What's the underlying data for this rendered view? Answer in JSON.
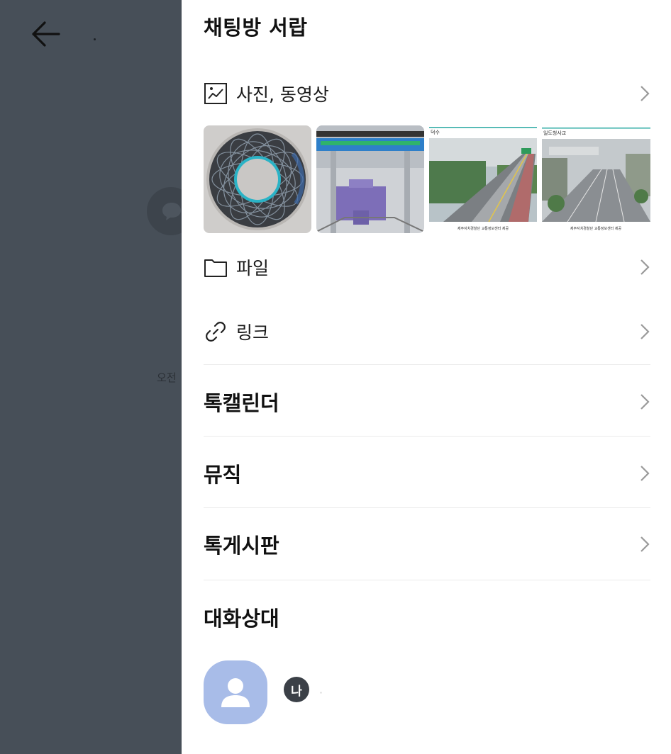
{
  "background": {
    "time_text": "오전",
    "colors": {
      "overlay": "#474f58",
      "bubble": "#3d444c"
    },
    "icons": {
      "back": "arrow-left-icon",
      "bubble": "chat-bubble-icon"
    }
  },
  "drawer": {
    "title": "채팅방 서랍",
    "photos": {
      "label": "사진, 동영상",
      "icon": "image-icon",
      "thumbnails": [
        {
          "name": "circular-mesh-cad-render"
        },
        {
          "name": "cylinder-cross-section-render"
        },
        {
          "name": "traffic-cctv-road-1",
          "header": "덕수",
          "caption": "제주자치경찰단 교통정보센터 제공"
        },
        {
          "name": "traffic-cctv-road-2",
          "header": "일도청사교",
          "caption": "제주자치경찰단 교통정보센터 제공"
        }
      ]
    },
    "files": {
      "label": "파일",
      "icon": "folder-icon"
    },
    "links": {
      "label": "링크",
      "icon": "link-icon"
    },
    "sections": [
      {
        "key": "talk_calendar",
        "label": "톡캘린더"
      },
      {
        "key": "music",
        "label": "뮤직"
      },
      {
        "key": "talk_board",
        "label": "톡게시판"
      }
    ],
    "participants": {
      "title": "대화상대",
      "members": [
        {
          "me_badge": "나",
          "name": "·",
          "avatar_color": "#a8bce8"
        }
      ]
    },
    "colors": {
      "chevron": "#9a9a9a",
      "separator": "#ebebeb",
      "icon_stroke": "#222222"
    }
  }
}
